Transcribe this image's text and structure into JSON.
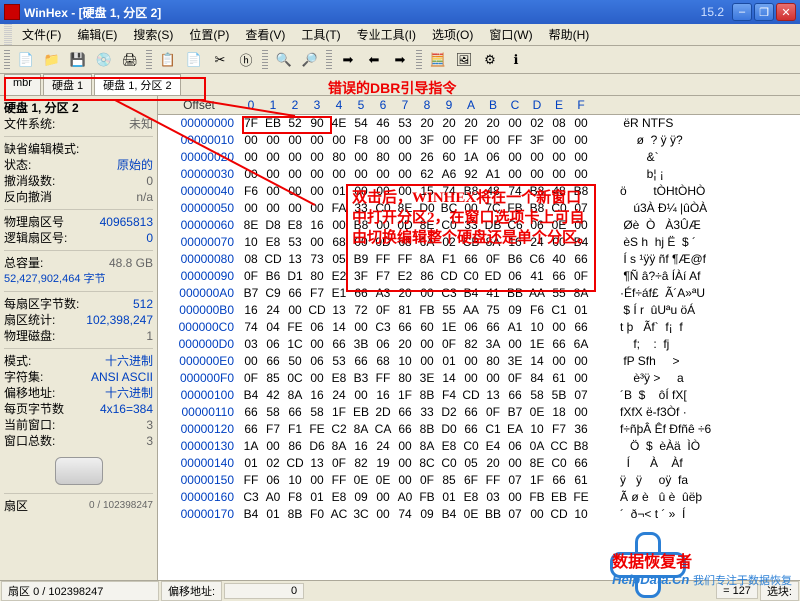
{
  "title": "WinHex - [硬盘 1, 分区 2]",
  "version": "15.2",
  "menu": [
    "文件(F)",
    "编辑(E)",
    "搜索(S)",
    "位置(P)",
    "查看(V)",
    "工具(T)",
    "专业工具(I)",
    "选项(O)",
    "窗口(W)",
    "帮助(H)"
  ],
  "tabs": [
    "mbr",
    "硬盘 1",
    "硬盘 1, 分区 2"
  ],
  "activeTab": 2,
  "sidebar": {
    "title": "硬盘 1, 分区 2",
    "fs_label": "文件系统:",
    "fs": "未知",
    "editmode_label": "缺省编辑模式:",
    "state_label": "状态:",
    "state": "原始的",
    "undo_label": "撤消级数:",
    "undo": "0",
    "rev_label": "反向撤消",
    "rev": "n/a",
    "physsec_label": "物理扇区号",
    "physsec": "40965813",
    "logsec_label": "逻辑扇区号:",
    "logsec": "0",
    "cap_label": "总容量:",
    "cap": "48.8 GB",
    "cap_bytes": "52,427,902,464 字节",
    "bps_label": "每扇区字节数:",
    "bps": "512",
    "seccount_label": "扇区统计:",
    "seccount": "102,398,247",
    "physdisk_label": "物理磁盘:",
    "physdisk": "1",
    "mode_label": "模式:",
    "mode": "十六进制",
    "charset_label": "字符集:",
    "charset": "ANSI ASCII",
    "offmode_label": "偏移地址:",
    "offmode": "十六进制",
    "bpp_label": "每页字节数",
    "bpp": "4x16=384",
    "curwin_label": "当前窗口:",
    "curwin": "3",
    "wincount_label": "窗口总数:",
    "wincount": "3",
    "sector_label": "扇区",
    "sector": "0 / 102398247"
  },
  "hexHeader": [
    "0",
    "1",
    "2",
    "3",
    "4",
    "5",
    "6",
    "7",
    "8",
    "9",
    "A",
    "B",
    "C",
    "D",
    "E",
    "F"
  ],
  "hexOffsetLabel": "Offset",
  "rows": [
    {
      "off": "00000000",
      "hex": [
        "7F",
        "EB",
        "52",
        "90",
        "4E",
        "54",
        "46",
        "53",
        "20",
        "20",
        "20",
        "20",
        "00",
        "02",
        "08",
        "00"
      ],
      "asc": " ëR NTFS"
    },
    {
      "off": "00000010",
      "hex": [
        "00",
        "00",
        "00",
        "00",
        "00",
        "F8",
        "00",
        "00",
        "3F",
        "00",
        "FF",
        "00",
        "FF",
        "3F",
        "00",
        "00"
      ],
      "asc": "     ø  ? ÿ ÿ?"
    },
    {
      "off": "00000020",
      "hex": [
        "00",
        "00",
        "00",
        "00",
        "80",
        "00",
        "80",
        "00",
        "26",
        "60",
        "1A",
        "06",
        "00",
        "00",
        "00",
        "00"
      ],
      "asc": "        &`"
    },
    {
      "off": "00000030",
      "hex": [
        "00",
        "00",
        "00",
        "00",
        "00",
        "00",
        "00",
        "00",
        "62",
        "A6",
        "92",
        "A1",
        "00",
        "00",
        "00",
        "00"
      ],
      "asc": "        b¦ ¡"
    },
    {
      "off": "00000040",
      "hex": [
        "F6",
        "00",
        "00",
        "00",
        "01",
        "00",
        "00",
        "00",
        "15",
        "74",
        "B8",
        "48",
        "74",
        "B8",
        "48",
        "B8"
      ],
      "asc": "ö        tÒHtÒHÒ"
    },
    {
      "off": "00000050",
      "hex": [
        "00",
        "00",
        "00",
        "00",
        "FA",
        "33",
        "C0",
        "8E",
        "D0",
        "BC",
        "00",
        "7C",
        "FB",
        "B8",
        "C0",
        "07"
      ],
      "asc": "    ú3À Ð¼ |ûÒÀ"
    },
    {
      "off": "00000060",
      "hex": [
        "8E",
        "D8",
        "E8",
        "16",
        "00",
        "B8",
        "00",
        "0D",
        "8E",
        "C0",
        "33",
        "DB",
        "C6",
        "06",
        "0E",
        "00"
      ],
      "asc": " Øè  Ò   À3ÛÆ"
    },
    {
      "off": "00000070",
      "hex": [
        "10",
        "E8",
        "53",
        "00",
        "68",
        "00",
        "0D",
        "68",
        "6A",
        "02",
        "CB",
        "8A",
        "16",
        "24",
        "00",
        "B4"
      ],
      "asc": " èS h  hj Ë  $ ´"
    },
    {
      "off": "00000080",
      "hex": [
        "08",
        "CD",
        "13",
        "73",
        "05",
        "B9",
        "FF",
        "FF",
        "8A",
        "F1",
        "66",
        "0F",
        "B6",
        "C6",
        "40",
        "66"
      ],
      "asc": " Í s ¹ÿÿ ñf ¶Æ@f"
    },
    {
      "off": "00000090",
      "hex": [
        "0F",
        "B6",
        "D1",
        "80",
        "E2",
        "3F",
        "F7",
        "E2",
        "86",
        "CD",
        "C0",
        "ED",
        "06",
        "41",
        "66",
        "0F"
      ],
      "asc": " ¶Ñ â?÷â ÍÀí Af"
    },
    {
      "off": "000000A0",
      "hex": [
        "B7",
        "C9",
        "66",
        "F7",
        "E1",
        "66",
        "A3",
        "20",
        "00",
        "C3",
        "B4",
        "41",
        "BB",
        "AA",
        "55",
        "8A"
      ],
      "asc": "·Éf÷áf£  Ã´A»ªU"
    },
    {
      "off": "000000B0",
      "hex": [
        "16",
        "24",
        "00",
        "CD",
        "13",
        "72",
        "0F",
        "81",
        "FB",
        "55",
        "AA",
        "75",
        "09",
        "F6",
        "C1",
        "01"
      ],
      "asc": " $ Í r  ûUªu öÁ"
    },
    {
      "off": "000000C0",
      "hex": [
        "74",
        "04",
        "FE",
        "06",
        "14",
        "00",
        "C3",
        "66",
        "60",
        "1E",
        "06",
        "66",
        "A1",
        "10",
        "00",
        "66"
      ],
      "asc": "t þ   Ãf`  f¡  f"
    },
    {
      "off": "000000D0",
      "hex": [
        "03",
        "06",
        "1C",
        "00",
        "66",
        "3B",
        "06",
        "20",
        "00",
        "0F",
        "82",
        "3A",
        "00",
        "1E",
        "66",
        "6A"
      ],
      "asc": "    f;    :  fj"
    },
    {
      "off": "000000E0",
      "hex": [
        "00",
        "66",
        "50",
        "06",
        "53",
        "66",
        "68",
        "10",
        "00",
        "01",
        "00",
        "80",
        "3E",
        "14",
        "00",
        "00"
      ],
      "asc": " fP Sfh     >"
    },
    {
      "off": "000000F0",
      "hex": [
        "0F",
        "85",
        "0C",
        "00",
        "E8",
        "B3",
        "FF",
        "80",
        "3E",
        "14",
        "00",
        "00",
        "0F",
        "84",
        "61",
        "00"
      ],
      "asc": "    è³ÿ >     a"
    },
    {
      "off": "00000100",
      "hex": [
        "B4",
        "42",
        "8A",
        "16",
        "24",
        "00",
        "16",
        "1F",
        "8B",
        "F4",
        "CD",
        "13",
        "66",
        "58",
        "5B",
        "07"
      ],
      "asc": "´B  $    ôÍ fX["
    },
    {
      "off": "00000110",
      "hex": [
        "66",
        "58",
        "66",
        "58",
        "1F",
        "EB",
        "2D",
        "66",
        "33",
        "D2",
        "66",
        "0F",
        "B7",
        "0E",
        "18",
        "00"
      ],
      "asc": "fXfX ë-f3Òf ·"
    },
    {
      "off": "00000120",
      "hex": [
        "66",
        "F7",
        "F1",
        "FE",
        "C2",
        "8A",
        "CA",
        "66",
        "8B",
        "D0",
        "66",
        "C1",
        "EA",
        "10",
        "F7",
        "36"
      ],
      "asc": "f÷ñþÂ Êf Ðfñê ÷6"
    },
    {
      "off": "00000130",
      "hex": [
        "1A",
        "00",
        "86",
        "D6",
        "8A",
        "16",
        "24",
        "00",
        "8A",
        "E8",
        "C0",
        "E4",
        "06",
        "0A",
        "CC",
        "B8"
      ],
      "asc": "   Ö  $  èÀä  ÌÒ"
    },
    {
      "off": "00000140",
      "hex": [
        "01",
        "02",
        "CD",
        "13",
        "0F",
        "82",
        "19",
        "00",
        "8C",
        "C0",
        "05",
        "20",
        "00",
        "8E",
        "C0",
        "66"
      ],
      "asc": "  Í      À    Àf"
    },
    {
      "off": "00000150",
      "hex": [
        "FF",
        "06",
        "10",
        "00",
        "FF",
        "0E",
        "0E",
        "00",
        "0F",
        "85",
        "6F",
        "FF",
        "07",
        "1F",
        "66",
        "61"
      ],
      "asc": "ÿ   ÿ     oÿ  fa"
    },
    {
      "off": "00000160",
      "hex": [
        "C3",
        "A0",
        "F8",
        "01",
        "E8",
        "09",
        "00",
        "A0",
        "FB",
        "01",
        "E8",
        "03",
        "00",
        "FB",
        "EB",
        "FE"
      ],
      "asc": "Ã ø è   û è  ûëþ"
    },
    {
      "off": "00000170",
      "hex": [
        "B4",
        "01",
        "8B",
        "F0",
        "AC",
        "3C",
        "00",
        "74",
        "09",
        "B4",
        "0E",
        "BB",
        "07",
        "00",
        "CD",
        "10"
      ],
      "asc": "´  ð¬< t ´ »  Í"
    }
  ],
  "statusbar": {
    "sector_label": "扇区",
    "sector_val": "0 / 102398247",
    "offset_label": "偏移地址:",
    "offset_val": "0",
    "val_label": "= 127",
    "sel_label": "选块:"
  },
  "annotations": {
    "top": "错误的DBR引导指令",
    "body": "双击后，WINHEX将在一个新窗口中打开分区2，在窗口选项卡上可自由切换编辑整个硬盘还是单个分区。"
  },
  "watermark": {
    "brand": "数据恢复者",
    "url": "HelpData.Cn",
    "slogan": "我们专注于数据恢复"
  }
}
